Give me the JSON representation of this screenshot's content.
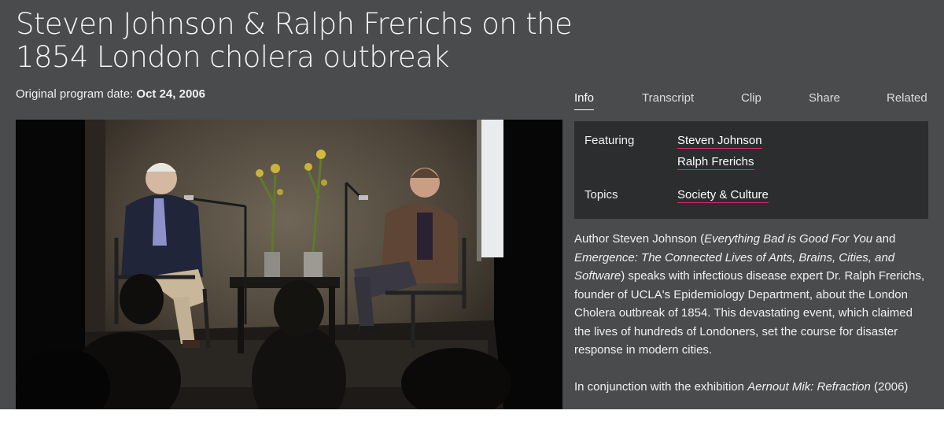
{
  "header": {
    "title": "Steven Johnson & Ralph Frerichs on the 1854 London cholera outbreak",
    "date_label": "Original program date:",
    "date_value": "Oct 24, 2006"
  },
  "tabs": [
    {
      "label": "Info",
      "active": true
    },
    {
      "label": "Transcript",
      "active": false
    },
    {
      "label": "Clip",
      "active": false
    },
    {
      "label": "Share",
      "active": false
    },
    {
      "label": "Related",
      "active": false
    }
  ],
  "info": {
    "featuring_label": "Featuring",
    "featuring": [
      "Steven Johnson",
      "Ralph Frerichs"
    ],
    "topics_label": "Topics",
    "topics": [
      "Society & Culture"
    ]
  },
  "description": {
    "p1_a": "Author Steven Johnson (",
    "p1_b": "Everything Bad is Good For You",
    "p1_c": " and ",
    "p1_d": "Emergence: The Connected Lives of Ants, Brains, Cities, and Software",
    "p1_e": ") speaks with infectious disease expert Dr. Ralph Frerichs, founder of UCLA's Epidemiology Department, about the London Cholera outbreak of 1854. This devastating event, which claimed the lives of hundreds of Londoners, set the course for disaster response in modern cities.",
    "p2_a": "In conjunction with the exhibition ",
    "p2_b": "Aernout Mik: Refraction",
    "p2_c": " (2006)"
  },
  "colors": {
    "background": "#4a4b4d",
    "info_box": "#2c2d2e",
    "link_underline": "#e0257e"
  }
}
